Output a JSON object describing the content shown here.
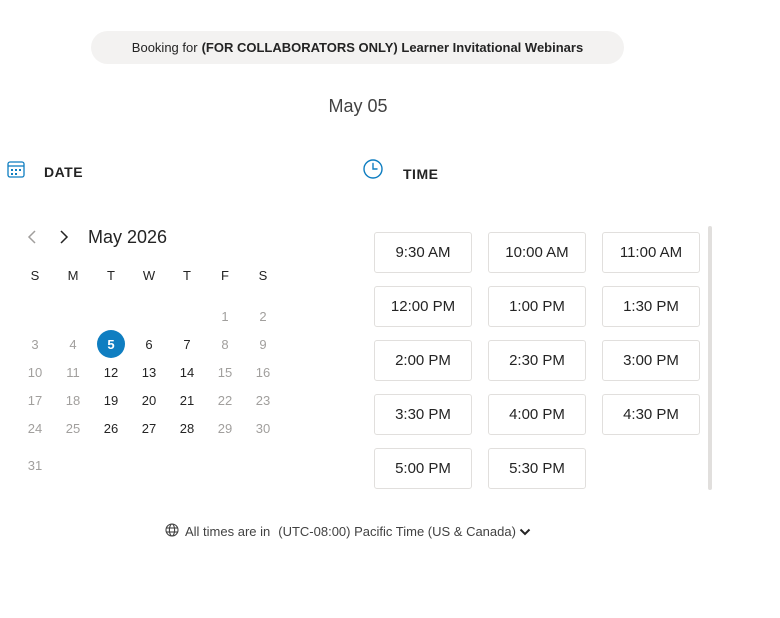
{
  "header": {
    "booking_prefix": "Booking for",
    "service_name": "(FOR COLLABORATORS ONLY) Learner Invitational Webinars"
  },
  "selected_date_label": "May 05",
  "date_section": {
    "label": "DATE",
    "icon": "calendar-icon"
  },
  "time_section": {
    "label": "TIME",
    "icon": "clock-icon"
  },
  "calendar": {
    "month_label": "May 2026",
    "weekdays": [
      "S",
      "M",
      "T",
      "W",
      "T",
      "F",
      "S"
    ],
    "weeks": [
      [
        "",
        "",
        "",
        "",
        "",
        "1",
        "2"
      ],
      [
        "3",
        "4",
        "5",
        "6",
        "7",
        "8",
        "9"
      ],
      [
        "10",
        "11",
        "12",
        "13",
        "14",
        "15",
        "16"
      ],
      [
        "17",
        "18",
        "19",
        "20",
        "21",
        "22",
        "23"
      ],
      [
        "24",
        "25",
        "26",
        "27",
        "28",
        "29",
        "30"
      ],
      [
        "31",
        "",
        "",
        "",
        "",
        "",
        ""
      ]
    ],
    "available_days": [
      "5",
      "6",
      "7",
      "12",
      "13",
      "14",
      "19",
      "20",
      "21",
      "26",
      "27",
      "28"
    ],
    "selected_day": "5"
  },
  "time_slots": [
    "9:30 AM",
    "10:00 AM",
    "11:00 AM",
    "12:00 PM",
    "1:00 PM",
    "1:30 PM",
    "2:00 PM",
    "2:30 PM",
    "3:00 PM",
    "3:30 PM",
    "4:00 PM",
    "4:30 PM",
    "5:00 PM",
    "5:30 PM"
  ],
  "timezone": {
    "prefix": "All times are in",
    "value": "(UTC-08:00) Pacific Time (US & Canada)"
  },
  "colors": {
    "accent": "#0f7ec1",
    "pill_background": "#f3f2f1",
    "disabled_text": "#a19f9d"
  }
}
